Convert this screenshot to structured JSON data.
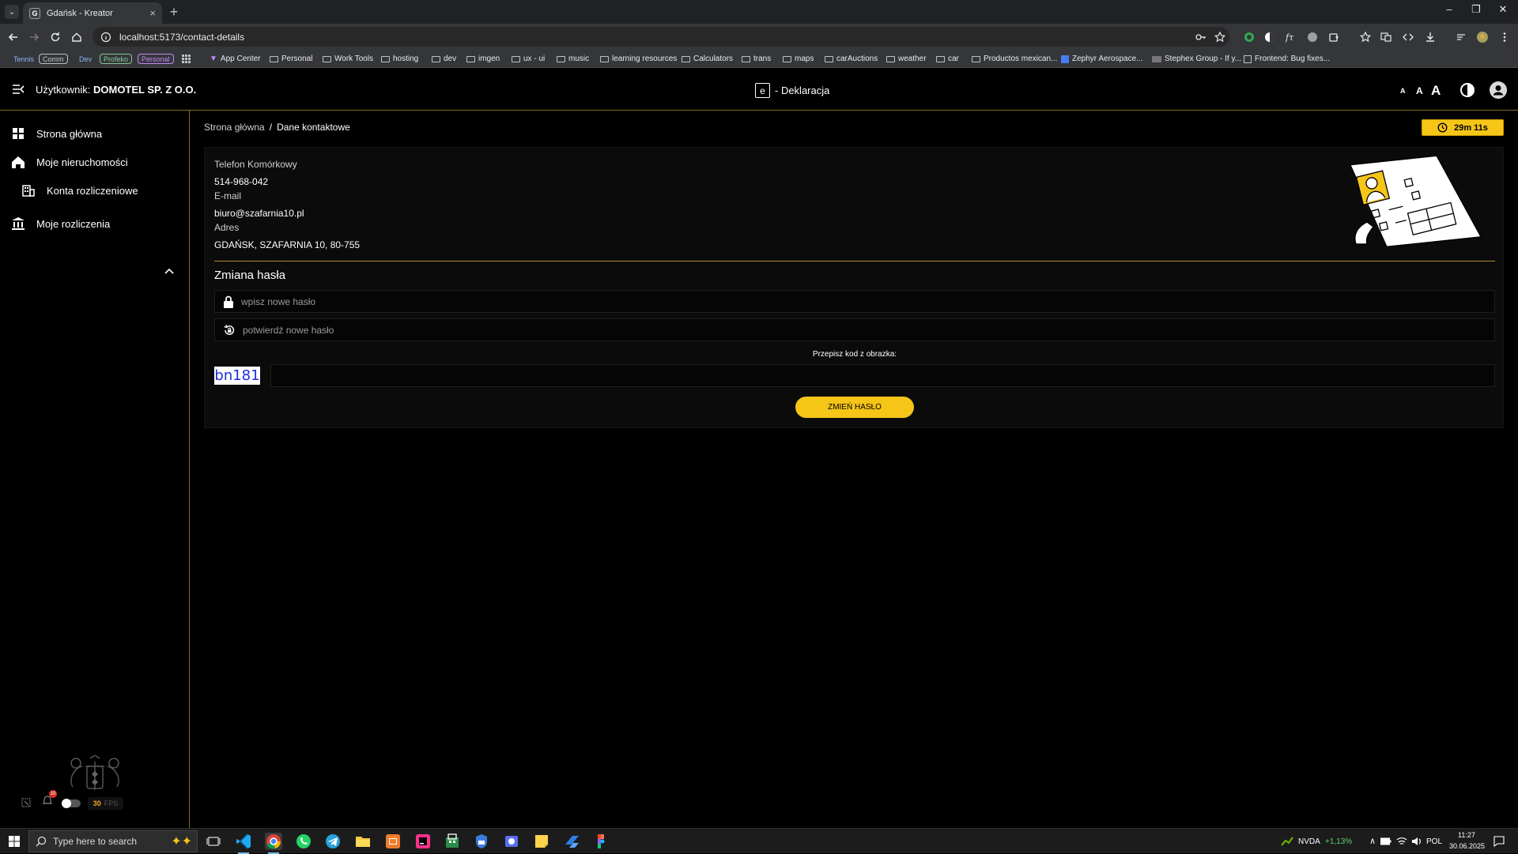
{
  "browser": {
    "tab_title": "Gdańsk - Kreator",
    "favicon_letter": "G",
    "url": "localhost:5173/contact-details",
    "bookmarks": {
      "chips": [
        {
          "label": "Tennis",
          "color": "#8ab4f8"
        },
        {
          "label": "Comm",
          "color": "#bdc1c6"
        },
        {
          "label": "Dev",
          "color": "#8ab4f8"
        },
        {
          "label": "Profeko",
          "color": "#81c995"
        },
        {
          "label": "Personal",
          "color": "#c58af9"
        }
      ],
      "items": [
        "App Center",
        "Personal",
        "Work Tools",
        "hosting",
        "dev",
        "imgen",
        "ux - ui",
        "music",
        "learning resources",
        "Calculators",
        "trans",
        "maps",
        "carAuctions",
        "weather",
        "car",
        "Productos mexican...",
        "Zephyr Aerospace...",
        "Stephex Group - If y...",
        "Frontend: Bug fixes..."
      ]
    }
  },
  "header": {
    "user_prefix": "Użytkownik:",
    "user_name": "DOMOTEL SP. Z O.O.",
    "brand_letter": "e",
    "brand_text": "- Deklaracja",
    "font_sizes": [
      "A",
      "A",
      "A"
    ]
  },
  "sidebar": {
    "items": [
      {
        "label": "Strona główna",
        "icon": "dashboard-icon"
      },
      {
        "label": "Moje nieruchomości",
        "icon": "home-icon"
      },
      {
        "label": "Konta rozliczeniowe",
        "icon": "building-icon"
      },
      {
        "label": "Moje rozliczenia",
        "icon": "bank-icon"
      }
    ],
    "notification_count": "10",
    "fps_value": "30",
    "fps_label": "FPS"
  },
  "breadcrumb": {
    "home": "Strona główna",
    "separator": "/",
    "current": "Dane kontaktowe"
  },
  "timer": "29m 11s",
  "contact": {
    "phone_label": "Telefon Komórkowy",
    "phone_value": "514-968-042",
    "email_label": "E-mail",
    "email_value": "biuro@szafarnia10.pl",
    "address_label": "Adres",
    "address_value": "GDAŃSK, SZAFARNIA 10, 80-755"
  },
  "password_change": {
    "title": "Zmiana hasła",
    "new_placeholder": "wpisz nowe hasło",
    "confirm_placeholder": "potwierdź nowe hasło",
    "captcha_label": "Przepisz kod z obrazka:",
    "captcha_code": "bn181",
    "submit_label": "ZMIEŃ HASŁO"
  },
  "taskbar": {
    "search_placeholder": "Type here to search",
    "stock_name": "NVDA",
    "stock_change": "+1,13%",
    "language": "POL",
    "time": "11:27",
    "date": "30.06.2025"
  },
  "colors": {
    "accent": "#f5c518",
    "border_gold": "#8a6d1f"
  }
}
